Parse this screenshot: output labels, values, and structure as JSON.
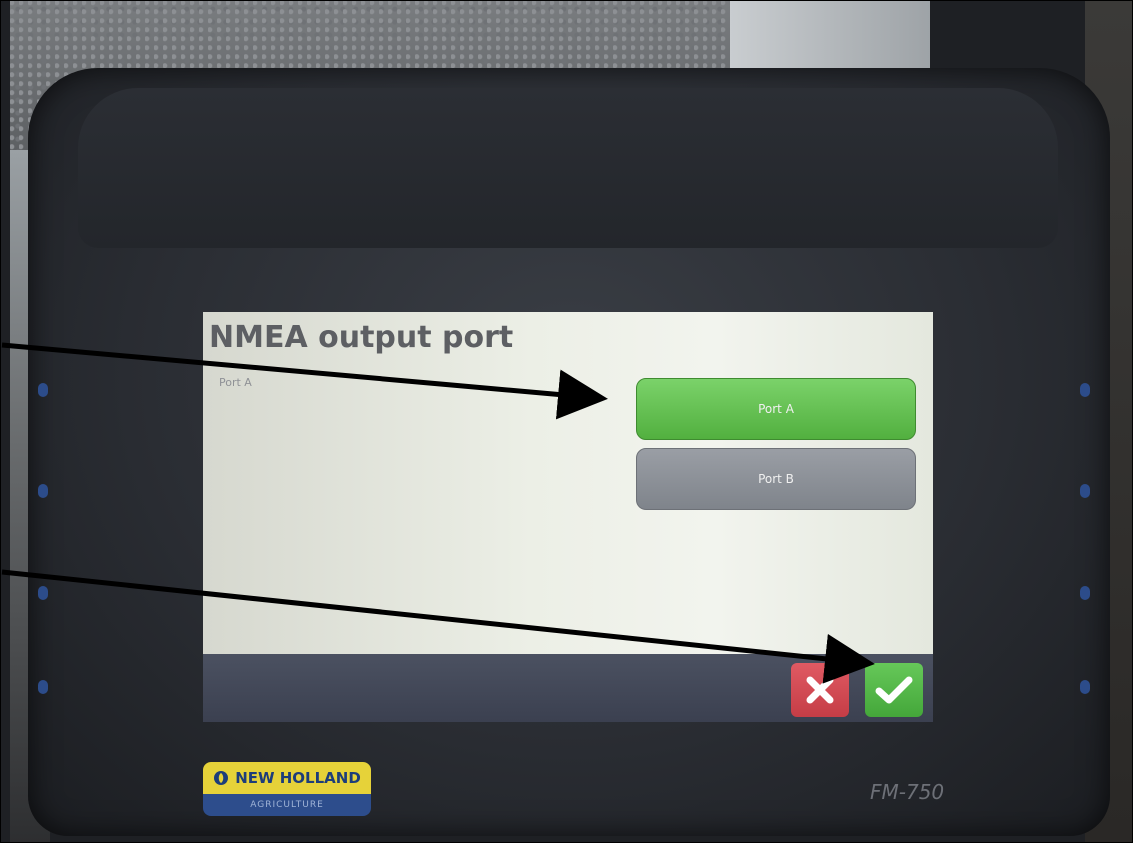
{
  "device": {
    "model": "FM-750",
    "brand_top": "NEW HOLLAND",
    "brand_bottom": "AGRICULTURE"
  },
  "screen": {
    "title": "NMEA output port",
    "current_value": "Port A",
    "options": [
      {
        "label": "Port A",
        "selected": true
      },
      {
        "label": "Port B",
        "selected": false
      }
    ],
    "actions": {
      "cancel_icon": "close-x-icon",
      "confirm_icon": "checkmark-icon"
    }
  },
  "colors": {
    "selected": "#5bbb48",
    "unselected": "#8a8e95",
    "cancel": "#d14a53",
    "confirm": "#52b546",
    "brand_yellow": "#e6d239",
    "brand_blue": "#2d4d8c"
  }
}
